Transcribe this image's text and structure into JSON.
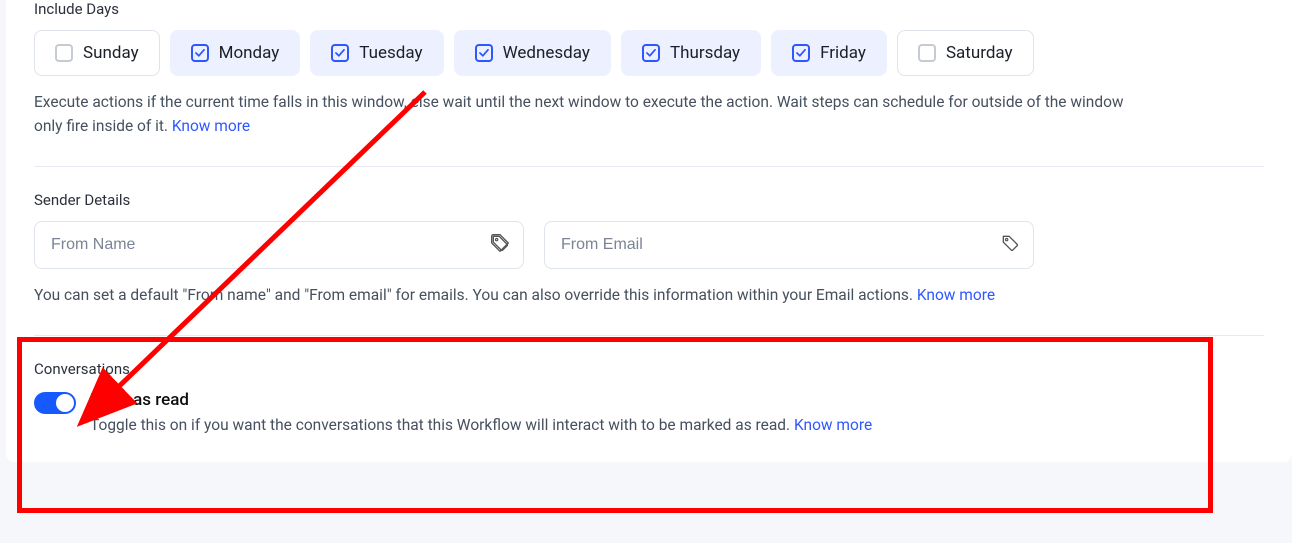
{
  "includeDays": {
    "title": "Include Days",
    "days": [
      {
        "label": "Sunday",
        "checked": false
      },
      {
        "label": "Monday",
        "checked": true
      },
      {
        "label": "Tuesday",
        "checked": true
      },
      {
        "label": "Wednesday",
        "checked": true
      },
      {
        "label": "Thursday",
        "checked": true
      },
      {
        "label": "Friday",
        "checked": true
      },
      {
        "label": "Saturday",
        "checked": false
      }
    ],
    "helpText1": "Execute actions if the current time falls in this window, else wait until the next window to execute the action. Wait steps can schedule for outside of the window",
    "helpText2": "only fire inside of it. ",
    "knowMore": "Know more"
  },
  "senderDetails": {
    "title": "Sender Details",
    "fromNamePlaceholder": "From Name",
    "fromEmailPlaceholder": "From Email",
    "helpText": "You can set a default \"From name\" and \"From email\" for emails. You can also override this information within your Email actions. ",
    "knowMore": "Know more"
  },
  "conversations": {
    "title": "Conversations",
    "markAsRead": "Mark as read",
    "helpText": "Toggle this on if you want the conversations that this Workflow will interact with to be marked as read. ",
    "knowMore": "Know more"
  }
}
